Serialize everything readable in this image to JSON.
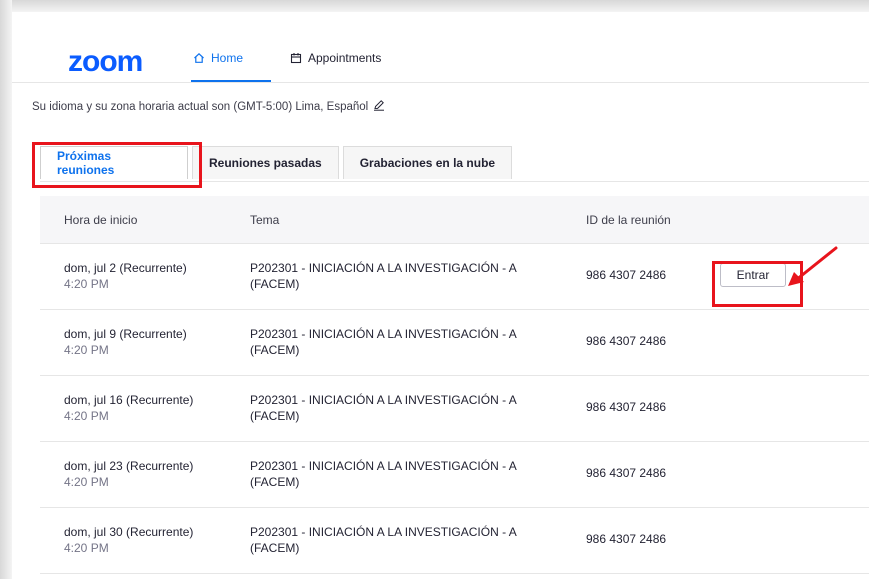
{
  "header": {
    "logo": "zoom",
    "nav": [
      {
        "label": "Home",
        "icon": "home-icon",
        "active": true
      },
      {
        "label": "Appointments",
        "icon": "calendar-icon",
        "active": false
      }
    ]
  },
  "timezone_text": "Su idioma y su zona horaria actual son (GMT-5:00) Lima, Español",
  "tabs": [
    {
      "label": "Próximas reuniones",
      "active": true
    },
    {
      "label": "Reuniones pasadas",
      "active": false
    },
    {
      "label": "Grabaciones en la nube",
      "active": false
    }
  ],
  "table": {
    "columns": [
      "Hora de inicio",
      "Tema",
      "ID de la reunión"
    ],
    "rows": [
      {
        "date": "dom, jul 2 (Recurrente)",
        "time": "4:20 PM",
        "topic": "P202301 - INICIACIÓN A LA INVESTIGACIÓN - A (FACEM)",
        "id": "986 4307 2486",
        "action": "Entrar"
      },
      {
        "date": "dom, jul 9 (Recurrente)",
        "time": "4:20 PM",
        "topic": "P202301 - INICIACIÓN A LA INVESTIGACIÓN - A (FACEM)",
        "id": "986 4307 2486"
      },
      {
        "date": "dom, jul 16 (Recurrente)",
        "time": "4:20 PM",
        "topic": "P202301 - INICIACIÓN A LA INVESTIGACIÓN - A (FACEM)",
        "id": "986 4307 2486"
      },
      {
        "date": "dom, jul 23 (Recurrente)",
        "time": "4:20 PM",
        "topic": "P202301 - INICIACIÓN A LA INVESTIGACIÓN - A (FACEM)",
        "id": "986 4307 2486"
      },
      {
        "date": "dom, jul 30 (Recurrente)",
        "time": "4:20 PM",
        "topic": "P202301 - INICIACIÓN A LA INVESTIGACIÓN - A (FACEM)",
        "id": "986 4307 2486"
      }
    ]
  },
  "colors": {
    "brand": "#0b5cff",
    "accent": "#0e72ed",
    "highlight": "#e8141c"
  }
}
